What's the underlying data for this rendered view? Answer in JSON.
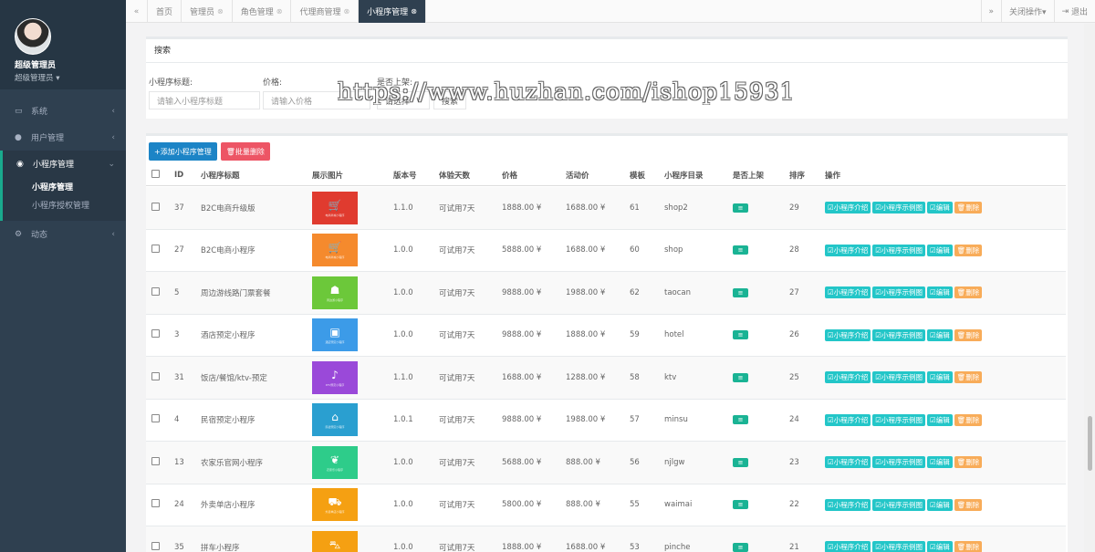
{
  "sidebar": {
    "user_name": "超级管理员",
    "user_role": "超级管理员",
    "role_caret": "▾",
    "items": [
      {
        "label": "系统",
        "icon": "monitor-icon",
        "glyph": "▭",
        "arrow": "‹"
      },
      {
        "label": "用户管理",
        "icon": "user-icon",
        "glyph": "●",
        "arrow": "‹"
      },
      {
        "label": "小程序管理",
        "icon": "comments-icon",
        "glyph": "◉",
        "arrow": "⌄"
      },
      {
        "label": "动态",
        "icon": "cogs-icon",
        "glyph": "⚙",
        "arrow": "‹"
      }
    ],
    "subitems": [
      {
        "label": "小程序管理"
      },
      {
        "label": "小程序授权管理"
      }
    ]
  },
  "tabbar": {
    "prev_glyph": "«",
    "next_glyph": "»",
    "tabs": [
      {
        "label": "首页",
        "close": ""
      },
      {
        "label": "管理员",
        "close": "⊗"
      },
      {
        "label": "角色管理",
        "close": "⊗"
      },
      {
        "label": "代理商管理",
        "close": "⊗"
      },
      {
        "label": "小程序管理",
        "close": "⊗"
      }
    ],
    "close_ops": "关闭操作▾",
    "logout": "退出",
    "logout_glyph": "⇥"
  },
  "search": {
    "title": "搜索",
    "title_label": "小程序标题:",
    "title_placeholder": "请输入小程序标题",
    "price_label": "价格:",
    "price_placeholder": "请输入价格",
    "shelf_label": "是否上架:",
    "shelf_value": "请选择",
    "shelf_caret": "∨",
    "search_value": "搜索"
  },
  "watermark": "https://www.huzhan.com/ishop15931",
  "toolbar": {
    "add_label": "+添加小程序管理",
    "delete_label": "🗑批量删除"
  },
  "table": {
    "headers": [
      "ID",
      "小程序标题",
      "展示图片",
      "版本号",
      "体验天数",
      "价格",
      "活动价",
      "模板",
      "小程序目录",
      "是否上架",
      "排序",
      "操作"
    ],
    "shelf_badge": "≡",
    "ops": [
      "☑小程序介绍",
      "☑小程序示例图",
      "☑编辑",
      "🗑删除"
    ],
    "rows": [
      {
        "id": "37",
        "title": "B2C电商升级版",
        "img_color": "#e03b2f",
        "img_glyph": "🛒",
        "img_cap": "电商商城小程序",
        "version": "1.1.0",
        "trial": "可试用7天",
        "price": "1888.00 ¥",
        "act": "1688.00 ¥",
        "tpl": "61",
        "dir": "shop2",
        "sort": "29"
      },
      {
        "id": "27",
        "title": "B2C电商小程序",
        "img_color": "#f58a2d",
        "img_glyph": "🛒",
        "img_cap": "电商商城小程序",
        "version": "1.0.0",
        "trial": "可试用7天",
        "price": "5888.00 ¥",
        "act": "1688.00 ¥",
        "tpl": "60",
        "dir": "shop",
        "sort": "28"
      },
      {
        "id": "5",
        "title": "周边游线路门票套餐",
        "img_color": "#6cc83a",
        "img_glyph": "☗",
        "img_cap": "周边游小程序",
        "version": "1.0.0",
        "trial": "可试用7天",
        "price": "9888.00 ¥",
        "act": "1988.00 ¥",
        "tpl": "62",
        "dir": "taocan",
        "sort": "27"
      },
      {
        "id": "3",
        "title": "酒店预定小程序",
        "img_color": "#3c9be8",
        "img_glyph": "▣",
        "img_cap": "酒店预定小程序",
        "version": "1.0.0",
        "trial": "可试用7天",
        "price": "9888.00 ¥",
        "act": "1888.00 ¥",
        "tpl": "59",
        "dir": "hotel",
        "sort": "26"
      },
      {
        "id": "31",
        "title": "饭店/餐馆/ktv-预定",
        "img_color": "#9a49d9",
        "img_glyph": "♪",
        "img_cap": "KTV预定小程序",
        "version": "1.1.0",
        "trial": "可试用7天",
        "price": "1688.00 ¥",
        "act": "1288.00 ¥",
        "tpl": "58",
        "dir": "ktv",
        "sort": "25"
      },
      {
        "id": "4",
        "title": "民宿预定小程序",
        "img_color": "#2a9fd0",
        "img_glyph": "⌂",
        "img_cap": "民宿预定小程序",
        "version": "1.0.1",
        "trial": "可试用7天",
        "price": "9888.00 ¥",
        "act": "1988.00 ¥",
        "tpl": "57",
        "dir": "minsu",
        "sort": "24"
      },
      {
        "id": "13",
        "title": "农家乐官网小程序",
        "img_color": "#2ecc8a",
        "img_glyph": "❦",
        "img_cap": "农家乐小程序",
        "version": "1.0.0",
        "trial": "可试用7天",
        "price": "5688.00 ¥",
        "act": "888.00 ¥",
        "tpl": "56",
        "dir": "njlgw",
        "sort": "23"
      },
      {
        "id": "24",
        "title": "外卖单店小程序",
        "img_color": "#f5a012",
        "img_glyph": "⛟",
        "img_cap": "外卖单店小程序",
        "version": "1.0.0",
        "trial": "可试用7天",
        "price": "5800.00 ¥",
        "act": "888.00 ¥",
        "tpl": "55",
        "dir": "waimai",
        "sort": "22"
      },
      {
        "id": "35",
        "title": "拼车小程序",
        "img_color": "#f5a012",
        "img_glyph": "⛍",
        "img_cap": "拼车小程序",
        "version": "1.0.0",
        "trial": "可试用7天",
        "price": "1888.00 ¥",
        "act": "1688.00 ¥",
        "tpl": "53",
        "dir": "pinche",
        "sort": "21"
      }
    ]
  }
}
